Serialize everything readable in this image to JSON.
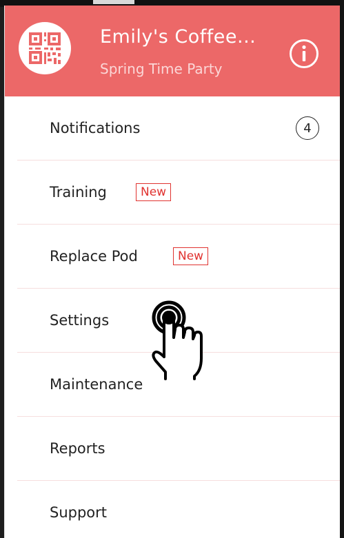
{
  "header": {
    "title": "Emily's Coffee...",
    "subtitle": "Spring Time Party",
    "avatar_icon": "qr-code-icon",
    "info_icon": "info-icon",
    "color": "#ec6868"
  },
  "menu": {
    "items": [
      {
        "label": "Notifications",
        "count": "4"
      },
      {
        "label": "Training",
        "badge": "New"
      },
      {
        "label": "Replace Pod",
        "badge": "New"
      },
      {
        "label": "Settings"
      },
      {
        "label": "Maintenance"
      },
      {
        "label": "Reports"
      },
      {
        "label": "Support"
      }
    ]
  },
  "colors": {
    "badge": "#e0322f",
    "divider": "#f6dede"
  },
  "pointer_icon": "hand-tap-icon"
}
